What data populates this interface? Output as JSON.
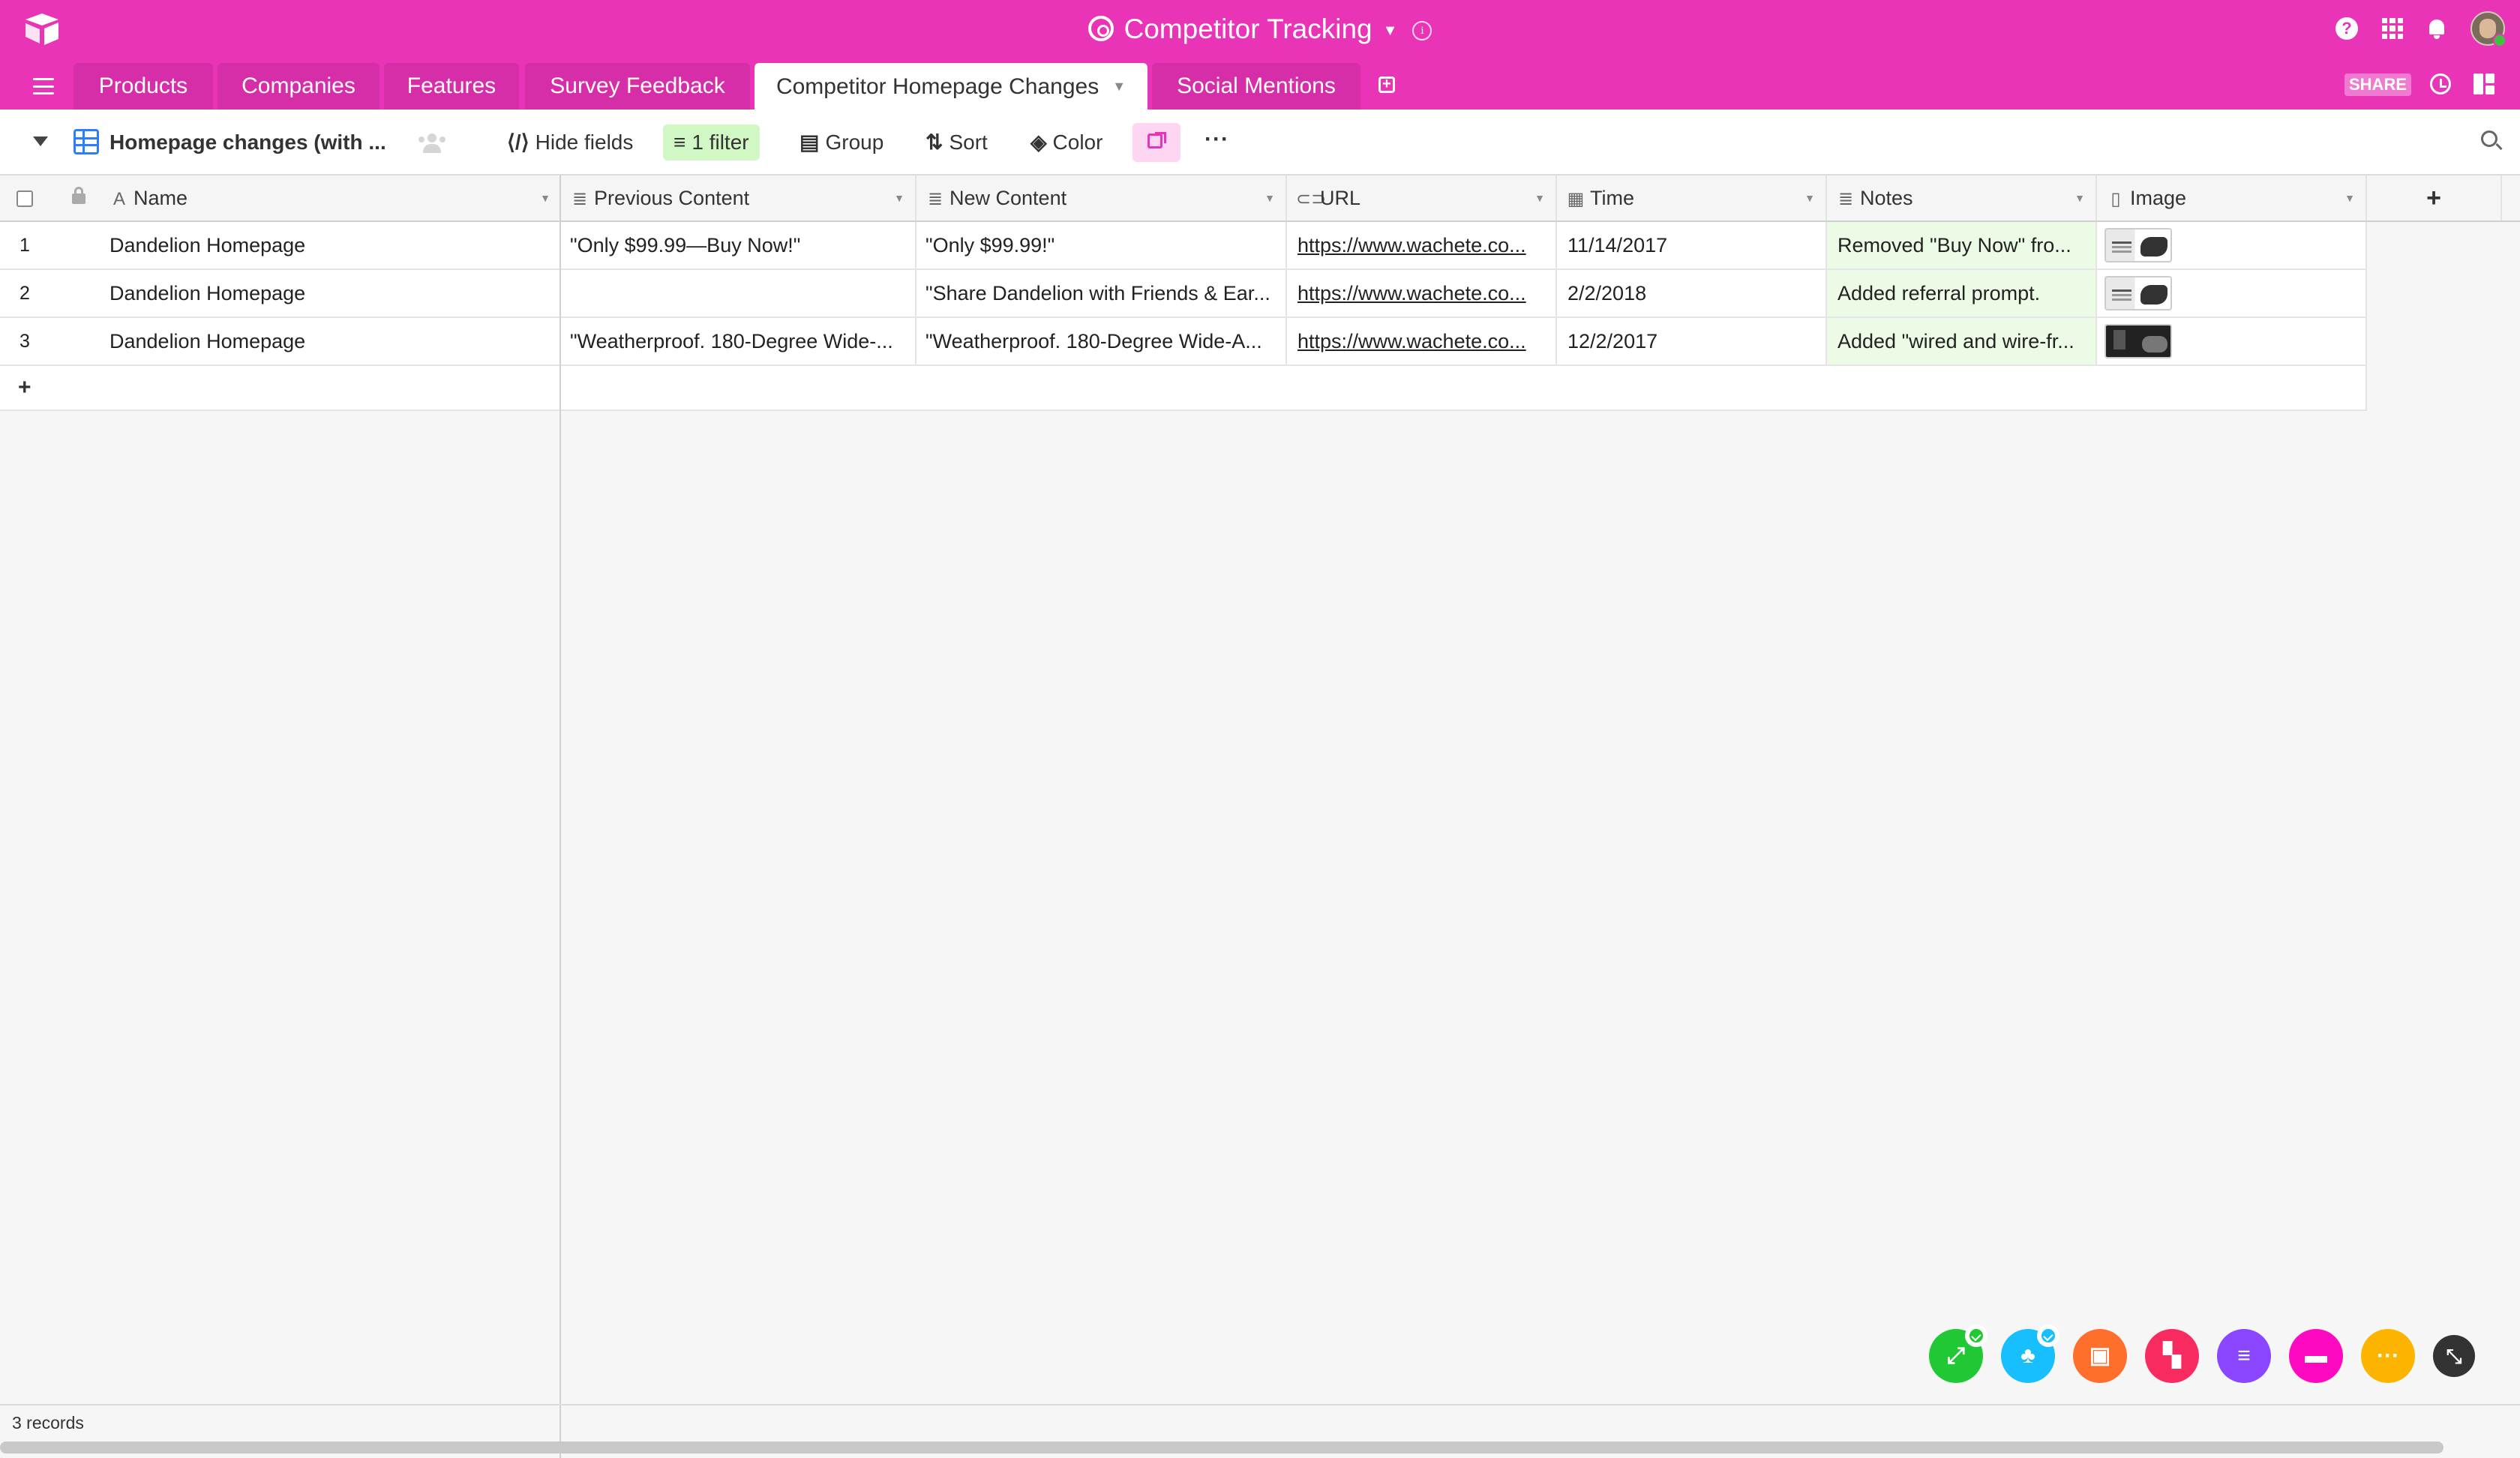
{
  "app": {
    "base_title": "Competitor Tracking",
    "share_label": "SHARE"
  },
  "tabs": [
    {
      "label": "Products"
    },
    {
      "label": "Companies"
    },
    {
      "label": "Features"
    },
    {
      "label": "Survey Feedback"
    },
    {
      "label": "Competitor Homepage Changes",
      "active": true
    },
    {
      "label": "Social Mentions"
    }
  ],
  "view": {
    "name": "Homepage changes (with ...",
    "hide_fields": "Hide fields",
    "filter": "1 filter",
    "group": "Group",
    "sort": "Sort",
    "color": "Color",
    "more": "···"
  },
  "columns": [
    {
      "label": "Name",
      "icon": "text-icon"
    },
    {
      "label": "Previous Content",
      "icon": "long-text-icon"
    },
    {
      "label": "New Content",
      "icon": "long-text-icon"
    },
    {
      "label": "URL",
      "icon": "link-icon"
    },
    {
      "label": "Time",
      "icon": "calendar-icon"
    },
    {
      "label": "Notes",
      "icon": "long-text-icon"
    },
    {
      "label": "Image",
      "icon": "attachment-icon"
    }
  ],
  "rows": [
    {
      "num": "1",
      "name": "Dandelion Homepage",
      "previous": "\"Only $99.99—Buy Now!\"",
      "new": "\"Only $99.99!\"",
      "url": "https://www.wachete.co...",
      "time": "11/14/2017",
      "notes": "Removed \"Buy Now\" fro...",
      "image": "light"
    },
    {
      "num": "2",
      "name": "Dandelion Homepage",
      "previous": "",
      "new": "\"Share Dandelion with Friends & Ear...",
      "url": "https://www.wachete.co...",
      "time": "2/2/2018",
      "notes": "Added referral prompt.",
      "image": "light"
    },
    {
      "num": "3",
      "name": "Dandelion Homepage",
      "previous": "\"Weatherproof. 180-Degree Wide-...",
      "new": "\"Weatherproof. 180-Degree Wide-A...",
      "url": "https://www.wachete.co...",
      "time": "12/2/2017",
      "notes": "Added \"wired and wire-fr...",
      "image": "dark"
    }
  ],
  "footer": {
    "records": "3 records"
  },
  "apps": [
    {
      "name": "green-app",
      "color": "#20c933"
    },
    {
      "name": "blue-app",
      "color": "#18bfff"
    },
    {
      "name": "orange-app",
      "color": "#ff6f2c"
    },
    {
      "name": "red-app",
      "color": "#f82b60"
    },
    {
      "name": "purple-app",
      "color": "#8b46ff"
    },
    {
      "name": "pink-app",
      "color": "#ff08c2"
    },
    {
      "name": "yellow-app",
      "color": "#fcb400"
    },
    {
      "name": "dark-app",
      "color": "#333333"
    }
  ],
  "colors": {
    "brand": "#e934b8",
    "filter_bg": "#d1f7c4",
    "notes_bg": "#ecfbe6"
  }
}
